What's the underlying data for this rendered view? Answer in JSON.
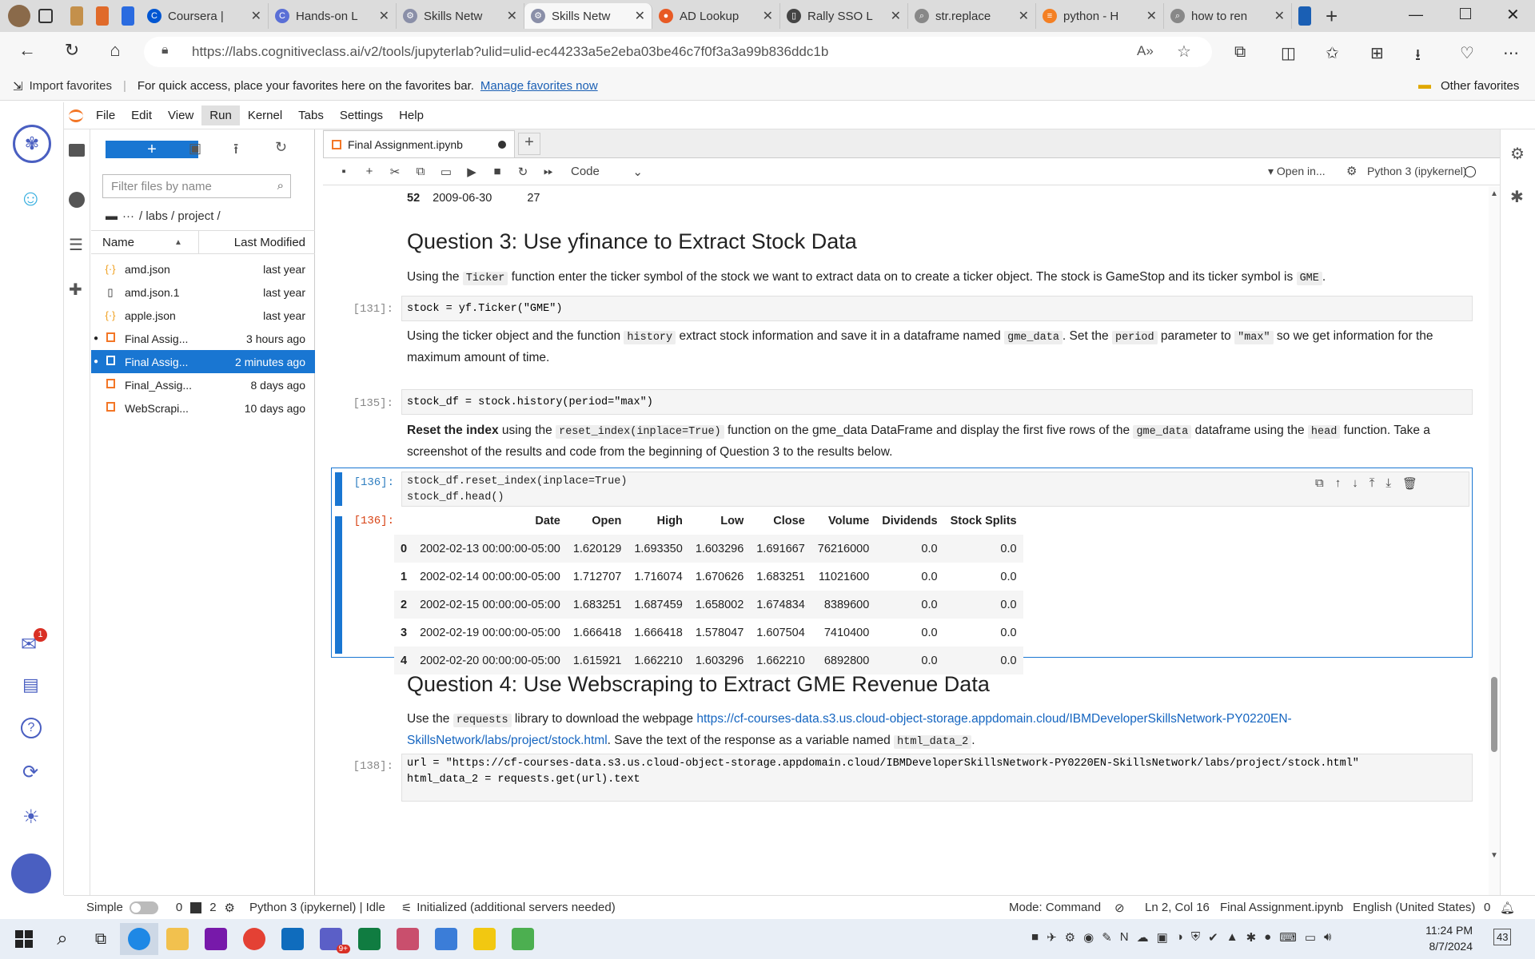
{
  "browser": {
    "tabs": [
      {
        "label": "Coursera |",
        "color": "#0056d2",
        "glyph": "C"
      },
      {
        "label": "Hands-on L",
        "color": "#5a6fd6",
        "glyph": "C"
      },
      {
        "label": "Skills Netw",
        "color": "#8a8fa8",
        "glyph": "⚙"
      },
      {
        "label": "Skills Netw",
        "color": "#8a8fa8",
        "glyph": "⚙"
      },
      {
        "label": "AD Lookup",
        "color": "#e85a24",
        "glyph": "●"
      },
      {
        "label": "Rally SSO L",
        "color": "#444444",
        "glyph": "▯"
      },
      {
        "label": "str.replace",
        "color": "#888888",
        "glyph": "⌕"
      },
      {
        "label": "python - H",
        "color": "#f48024",
        "glyph": "≡"
      },
      {
        "label": "how to ren",
        "color": "#888888",
        "glyph": "⌕"
      }
    ],
    "active_tab_index": 3,
    "url": "https://labs.cognitiveclass.ai/v2/tools/jupyterlab?ulid=ulid-ec44233a5e2eba03be46c7f0f3a3a99b836ddc1b",
    "favorites": {
      "import": "Import favorites",
      "message": "For quick access, place your favorites here on the favorites bar.",
      "manage_link": "Manage favorites now",
      "other": "Other favorites"
    }
  },
  "jupyter": {
    "menu": [
      "File",
      "Edit",
      "View",
      "Run",
      "Kernel",
      "Tabs",
      "Settings",
      "Help"
    ],
    "active_menu": "Run",
    "filter_placeholder": "Filter files by name",
    "breadcrumb": "/ labs / project /",
    "breadcrumb_ellipsis": "···",
    "file_headers": {
      "name": "Name",
      "modified": "Last Modified"
    },
    "files": [
      {
        "name": "amd.json",
        "modified": "last year",
        "type": "json",
        "running": false,
        "selected": false
      },
      {
        "name": "amd.json.1",
        "modified": "last year",
        "type": "file",
        "running": false,
        "selected": false
      },
      {
        "name": "apple.json",
        "modified": "last year",
        "type": "json",
        "running": false,
        "selected": false
      },
      {
        "name": "Final Assig...",
        "modified": "3 hours ago",
        "type": "notebook",
        "running": true,
        "selected": false
      },
      {
        "name": "Final Assig...",
        "modified": "2 minutes ago",
        "type": "notebook",
        "running": true,
        "selected": true
      },
      {
        "name": "Final_Assig...",
        "modified": "8 days ago",
        "type": "notebook",
        "running": false,
        "selected": false
      },
      {
        "name": "WebScrapi...",
        "modified": "10 days ago",
        "type": "notebook",
        "running": false,
        "selected": false
      }
    ],
    "doc_tab": "Final Assignment.ipynb",
    "cell_type": "Code",
    "open_in": "Open in...",
    "kernel": "Python 3 (ipykernel)",
    "notebook": {
      "prev_row": {
        "index": "52",
        "date": "2009-06-30",
        "value": "27"
      },
      "q3_title": "Question 3: Use yfinance to Extract Stock Data",
      "q3_text_a": "Using the",
      "q3_code_a": "Ticker",
      "q3_text_b": "function enter the ticker symbol of the stock we want to extract data on to create a ticker object. The stock is GameStop and its ticker symbol is",
      "q3_code_b": "GME",
      "q3_text_c": ".",
      "cell131_prompt": "[131]:",
      "cell131_code": "stock = yf.Ticker(\"GME\")",
      "md2_a": "Using the ticker object and the function",
      "md2_code1": "history",
      "md2_b": "extract stock information and save it in a dataframe named",
      "md2_code2": "gme_data",
      "md2_c": ". Set the",
      "md2_code3": "period",
      "md2_d": "parameter to",
      "md2_code4": "\"max\"",
      "md2_e": "so we get information for the maximum amount of time.",
      "cell135_prompt": "[135]:",
      "cell135_code": "stock_df = stock.history(period=\"max\")",
      "md3_bold": "Reset the index",
      "md3_a": "using the",
      "md3_code1": "reset_index(inplace=True)",
      "md3_b": "function on the gme_data DataFrame and display the first five rows of the",
      "md3_code2": "gme_data",
      "md3_c": "dataframe using the",
      "md3_code3": "head",
      "md3_d": "function. Take a screenshot of the results and code from the beginning of Question 3 to the results below.",
      "cell136_prompt": "[136]:",
      "cell136_line1": "stock_df.reset_index(inplace=True)",
      "cell136_line2": "stock_df.head()",
      "out136_prompt": "[136]:",
      "table": {
        "columns": [
          "",
          "Date",
          "Open",
          "High",
          "Low",
          "Close",
          "Volume",
          "Dividends",
          "Stock Splits"
        ],
        "rows": [
          [
            "0",
            "2002-02-13 00:00:00-05:00",
            "1.620129",
            "1.693350",
            "1.603296",
            "1.691667",
            "76216000",
            "0.0",
            "0.0"
          ],
          [
            "1",
            "2002-02-14 00:00:00-05:00",
            "1.712707",
            "1.716074",
            "1.670626",
            "1.683251",
            "11021600",
            "0.0",
            "0.0"
          ],
          [
            "2",
            "2002-02-15 00:00:00-05:00",
            "1.683251",
            "1.687459",
            "1.658002",
            "1.674834",
            "8389600",
            "0.0",
            "0.0"
          ],
          [
            "3",
            "2002-02-19 00:00:00-05:00",
            "1.666418",
            "1.666418",
            "1.578047",
            "1.607504",
            "7410400",
            "0.0",
            "0.0"
          ],
          [
            "4",
            "2002-02-20 00:00:00-05:00",
            "1.615921",
            "1.662210",
            "1.603296",
            "1.662210",
            "6892800",
            "0.0",
            "0.0"
          ]
        ]
      },
      "q4_title": "Question 4: Use Webscraping to Extract GME Revenue Data",
      "q4_a": "Use the",
      "q4_code1": "requests",
      "q4_b": "library to download the webpage",
      "q4_link": "https://cf-courses-data.s3.us.cloud-object-storage.appdomain.cloud/IBMDeveloperSkillsNetwork-PY0220EN-SkillsNetwork/labs/project/stock.html",
      "q4_c": ". Save the text of the response as a variable named",
      "q4_code2": "html_data_2",
      "q4_d": ".",
      "cell138_prompt": "[138]:",
      "cell138_line1": "url = \"https://cf-courses-data.s3.us.cloud-object-storage.appdomain.cloud/IBMDeveloperSkillsNetwork-PY0220EN-SkillsNetwork/labs/project/stock.html\"",
      "cell138_line2": "html_data_2 = requests.get(url).text"
    },
    "status": {
      "simple": "Simple",
      "zero": "0",
      "terminals": "2",
      "kernel_state": "Python 3 (ipykernel) | Idle",
      "lsp": "Initialized (additional servers needed)",
      "mode": "Mode: Command",
      "position": "Ln 2, Col 16",
      "file": "Final Assignment.ipynb",
      "language": "English (United States)",
      "notif": "0"
    }
  },
  "taskbar": {
    "time": "11:24 PM",
    "date": "8/7/2024",
    "badge_teams": "9+",
    "notif_count": "43",
    "mail_badge": "1"
  },
  "colors": {
    "accent": "#1976d2",
    "jupyter_orange": "#f37626",
    "active_cell": "#1976d2"
  }
}
